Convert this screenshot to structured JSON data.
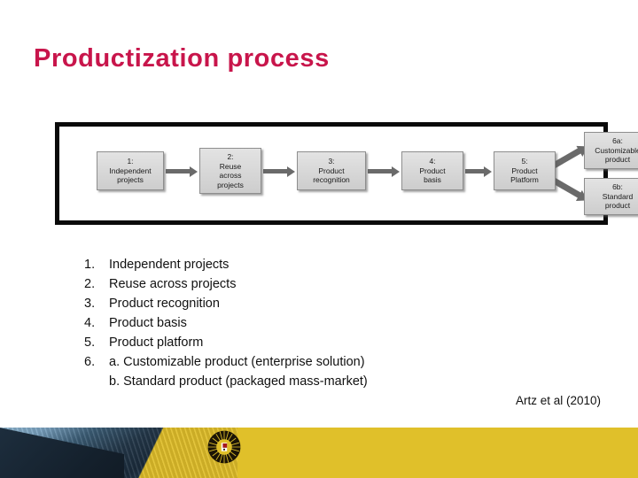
{
  "slide": {
    "title": "Productization process",
    "title_color": "#C8154B",
    "background": "#FFFFFF"
  },
  "diagram": {
    "name": "productization-process-flow",
    "frame_border_color": "#0A0A0A",
    "box_fill": "#D7D7D7",
    "box_border": "#8E8E8E",
    "arrow_color": "#6A6A6A",
    "boxes": [
      {
        "id": "1",
        "number": "1:",
        "label": "Independent projects",
        "line1": "Independent",
        "line2": "projects"
      },
      {
        "id": "2",
        "number": "2:",
        "label": "Reuse across projects",
        "line1": "Reuse",
        "line2": "across",
        "line3": "projects"
      },
      {
        "id": "3",
        "number": "3:",
        "label": "Product recognition",
        "line1": "Product",
        "line2": "recognition"
      },
      {
        "id": "4",
        "number": "4:",
        "label": "Product basis",
        "line1": "Product",
        "line2": "basis"
      },
      {
        "id": "5",
        "number": "5:",
        "label": "Product Platform",
        "line1": "Product",
        "line2": "Platform"
      },
      {
        "id": "6a",
        "number": "6a:",
        "label": "Customizable product",
        "line1": "Customizable",
        "line2": "product"
      },
      {
        "id": "6b",
        "number": "6b:",
        "label": "Standard product",
        "line1": "Standard",
        "line2": "product"
      }
    ]
  },
  "list": {
    "items": [
      {
        "num": "1.",
        "text": "Independent projects"
      },
      {
        "num": "2.",
        "text": "Reuse across projects"
      },
      {
        "num": "3.",
        "text": "Product recognition"
      },
      {
        "num": "4.",
        "text": "Product basis"
      },
      {
        "num": "5.",
        "text": "Product platform"
      },
      {
        "num": "6.",
        "sub_a": "a. Customizable product (enterprise solution)",
        "sub_b": "b. Standard product (packaged mass-market)"
      }
    ]
  },
  "citation": "Artz et al (2010)",
  "footer": {
    "band_color": "#E0C02A",
    "emblem": "university-sun-emblem",
    "photo": "building-photograph"
  }
}
